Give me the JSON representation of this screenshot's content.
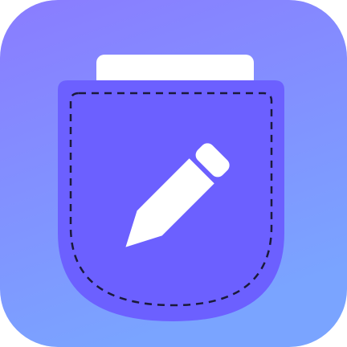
{
  "icon": {
    "name": "pocket-notes-app-icon",
    "glyph": "pencil-icon",
    "colors": {
      "background_gradient_top": "#8a7cff",
      "background_gradient_bottom": "#7aa4ff",
      "pocket_fill": "#6c60ff",
      "paper_fill": "#ffffff",
      "stitch": "#1b1a3a",
      "pencil_fill": "#ffffff"
    }
  }
}
